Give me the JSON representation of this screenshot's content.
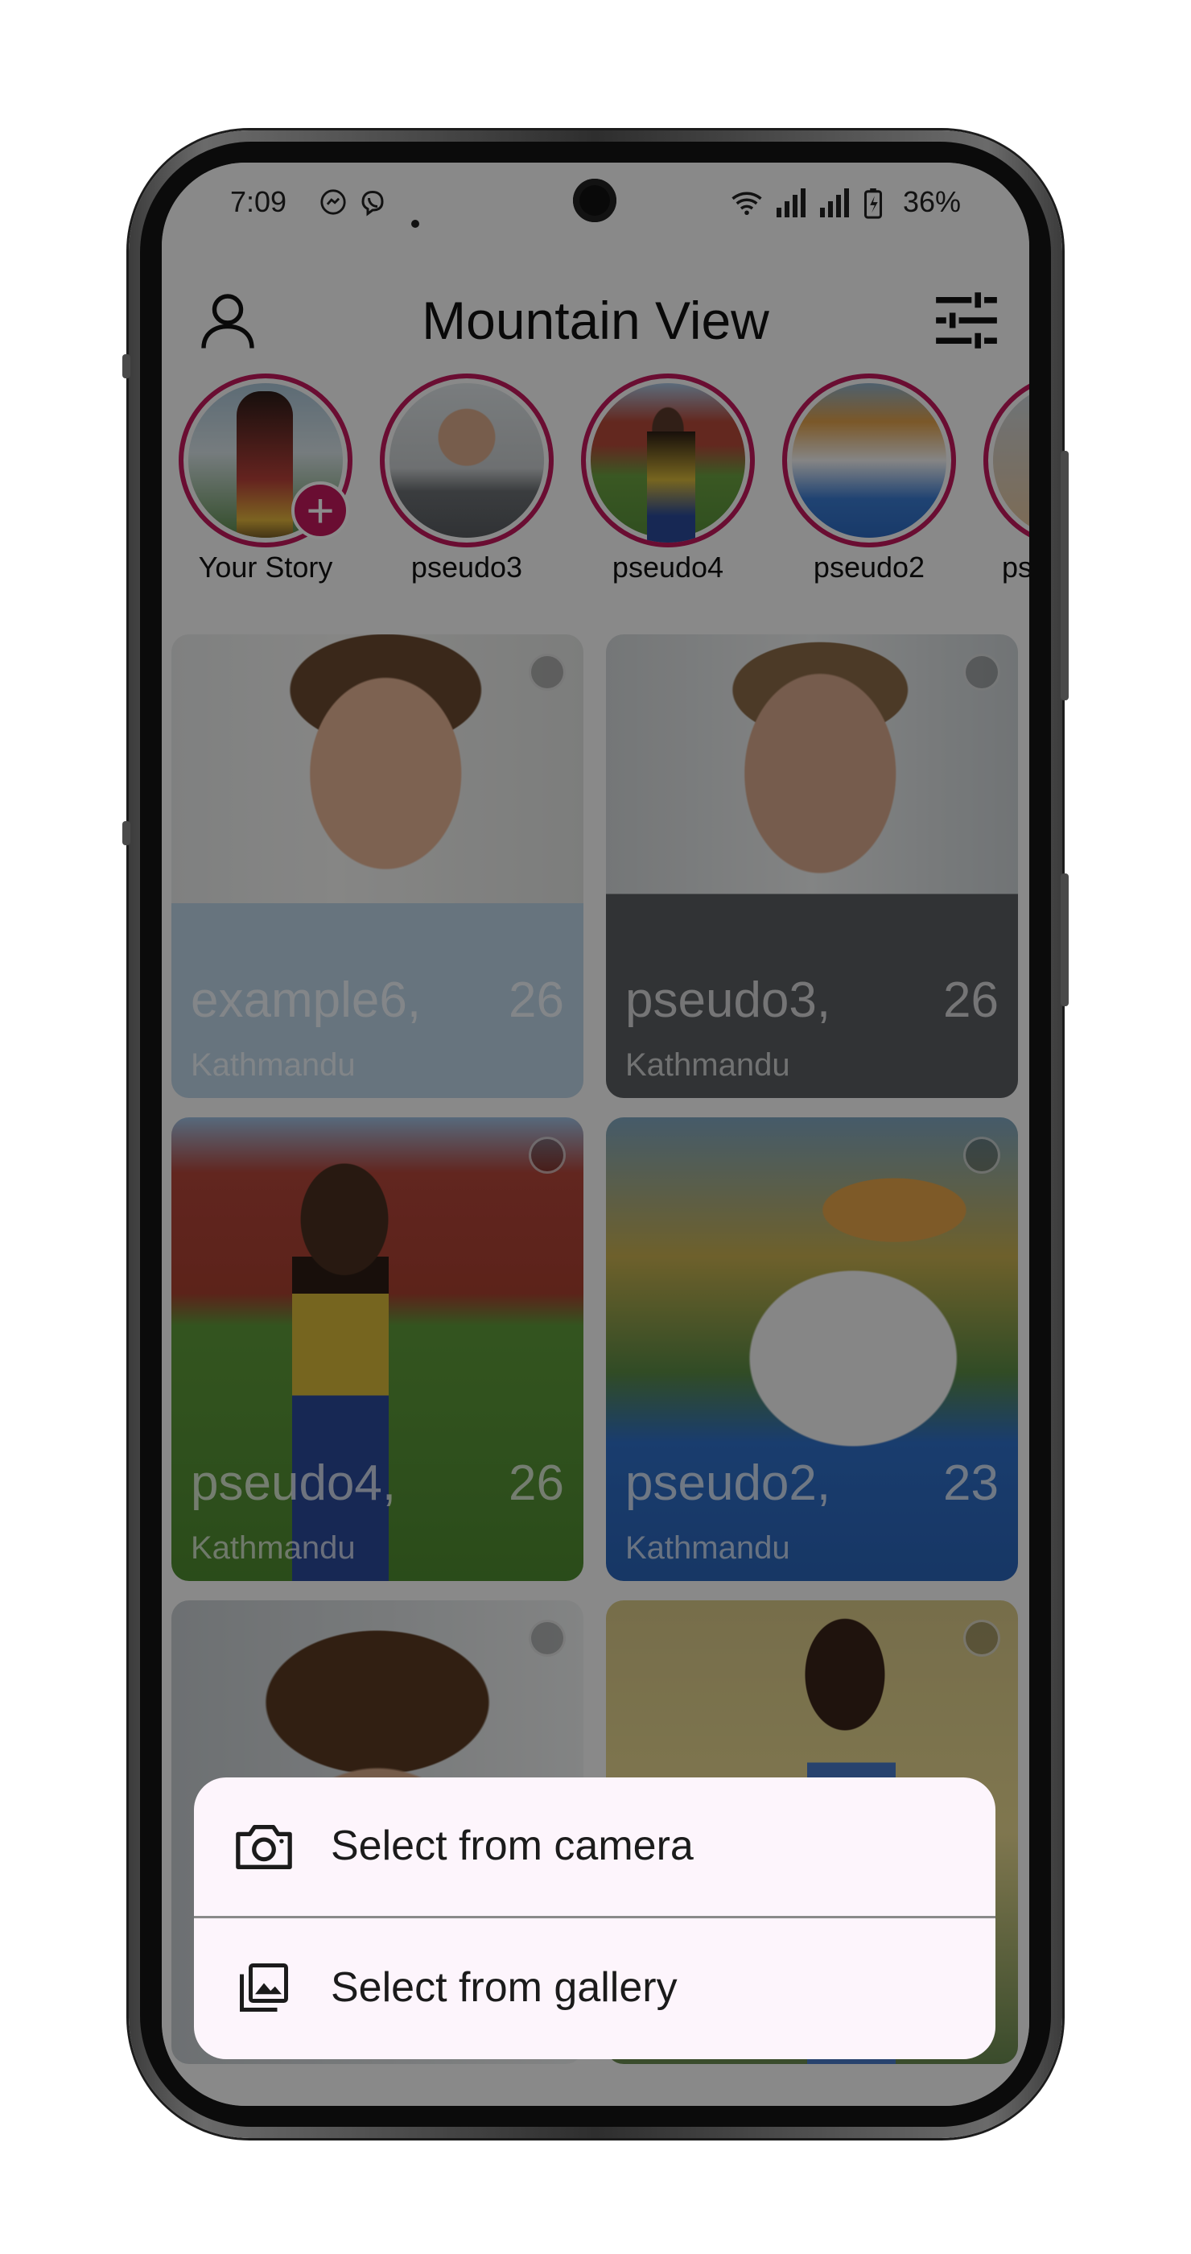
{
  "status_bar": {
    "time": "7:09",
    "battery": "36%"
  },
  "app_bar": {
    "title": "Mountain View"
  },
  "stories": [
    {
      "name": "Your Story",
      "is_own": true
    },
    {
      "name": "pseudo3"
    },
    {
      "name": "pseudo4"
    },
    {
      "name": "pseudo2"
    },
    {
      "name": "ps"
    }
  ],
  "cards": [
    {
      "name": "example6,",
      "age": "26",
      "city": "Kathmandu"
    },
    {
      "name": "pseudo3,",
      "age": "26",
      "city": "Kathmandu"
    },
    {
      "name": "pseudo4,",
      "age": "26",
      "city": "Kathmandu"
    },
    {
      "name": "pseudo2,",
      "age": "23",
      "city": "Kathmandu"
    }
  ],
  "sheet": {
    "camera_label": "Select from camera",
    "gallery_label": "Select from gallery"
  },
  "colors": {
    "accent": "#c2185b",
    "sheet_bg": "#fdf5fc"
  }
}
